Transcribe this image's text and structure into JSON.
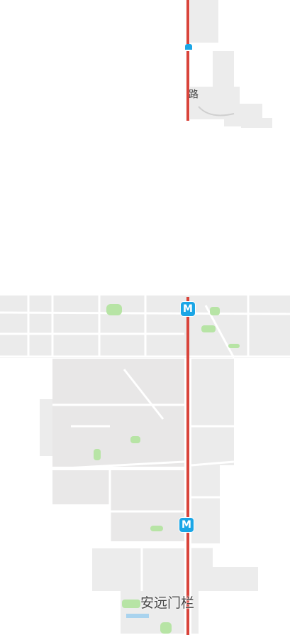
{
  "map": {
    "colors": {
      "background": "#ffffff",
      "block": "#eeeeee",
      "block_dark": "#e4e3e3",
      "road": "#ffffff",
      "metro_line": "#d9443b",
      "metro_icon": "#1ba6e6",
      "park": "#b7e4a5",
      "water": "#a9d3ee"
    },
    "metro_icon_text": "M",
    "labels": {
      "road_south": "安远门栏",
      "road_north_fragment": "路"
    },
    "icons": [
      "metro-station-icon"
    ]
  }
}
